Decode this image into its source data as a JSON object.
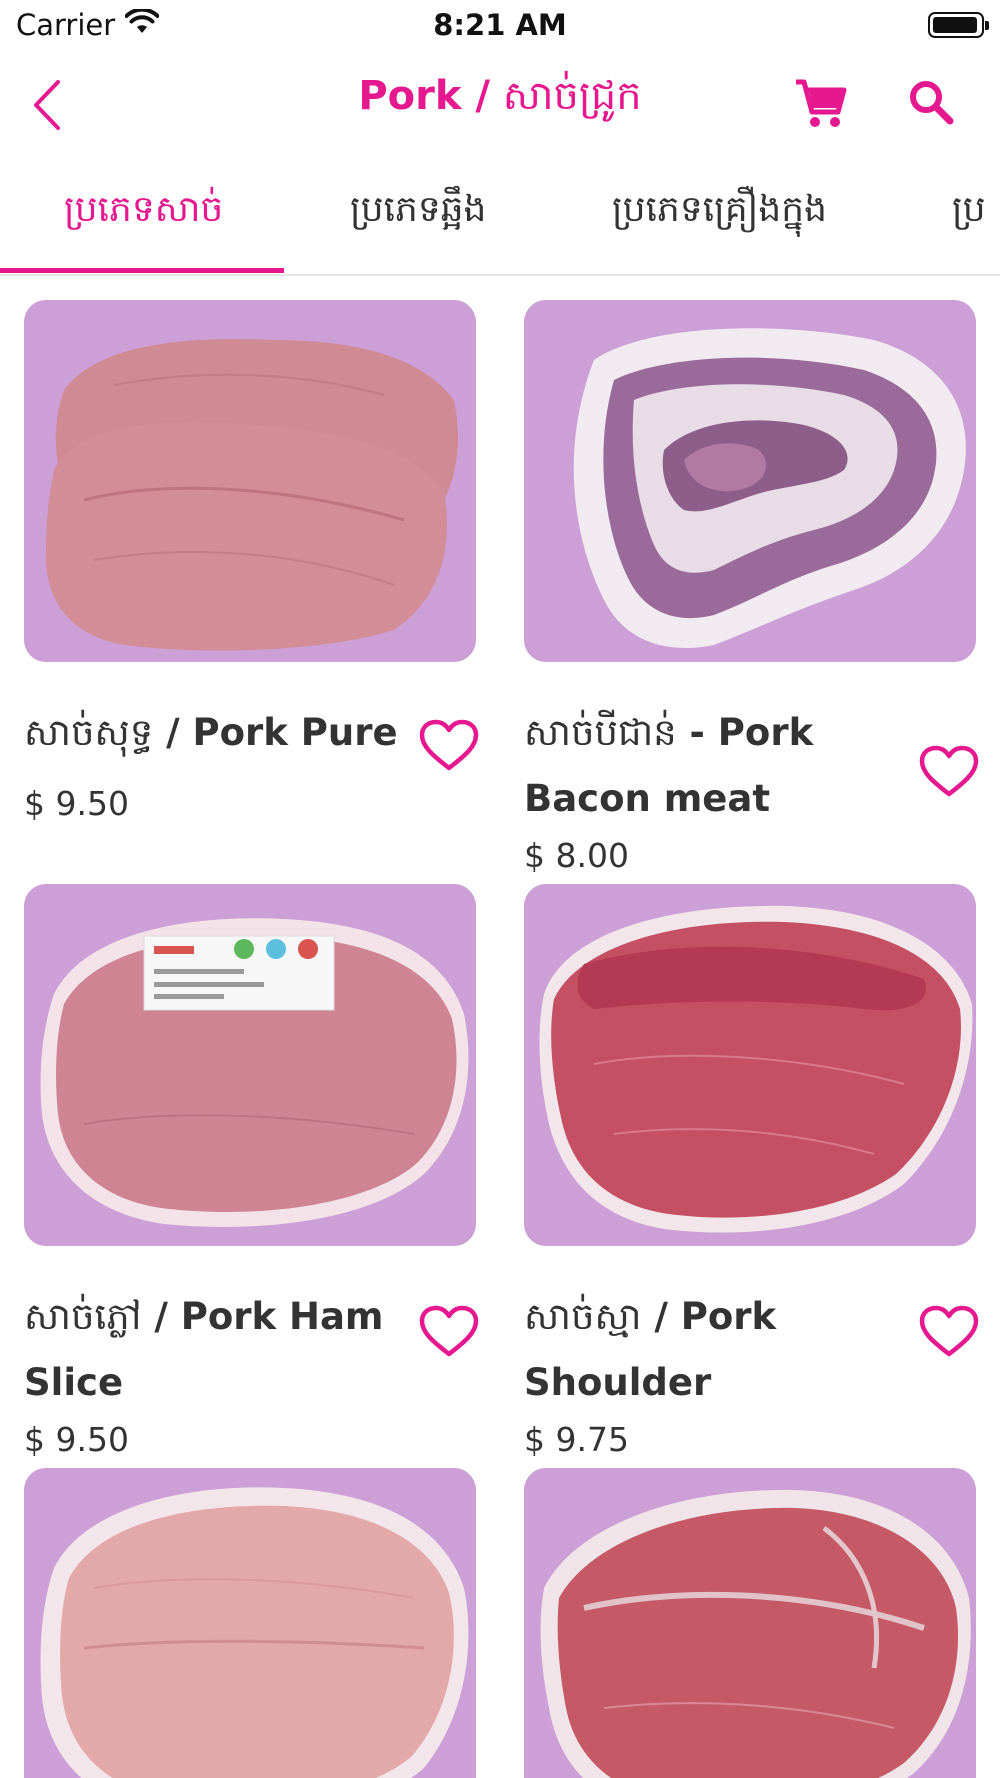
{
  "status_bar": {
    "carrier": "Carrier",
    "time": "8:21 AM"
  },
  "nav": {
    "title_en": "Pork /",
    "title_km": "សាច់ជ្រូក",
    "back_icon": "chevron-left-icon",
    "cart_icon": "cart-icon",
    "search_icon": "search-icon"
  },
  "tabs": [
    {
      "label": "ប្រភេទសាច់",
      "active": true
    },
    {
      "label": "ប្រភេទឆ្អឹង",
      "active": false
    },
    {
      "label": "ប្រភេទគ្រឿងក្នុង",
      "active": false
    },
    {
      "label": "ប្រ",
      "active": false
    }
  ],
  "products": [
    {
      "name_km": "សាច់សុទ្ធ",
      "name_en": " / Pork Pure",
      "price": "$ 9.50",
      "favorite_icon": "heart-outline-icon"
    },
    {
      "name_km": "សាច់បីជាន់",
      "name_en": " - Pork Bacon meat",
      "price": "$ 8.00",
      "favorite_icon": "heart-outline-icon"
    },
    {
      "name_km": "សាច់ភ្លៅ",
      "name_en": " / Pork Ham Slice",
      "price": "$ 9.50",
      "favorite_icon": "heart-outline-icon"
    },
    {
      "name_km": "សាច់ស្មា",
      "name_en": " / Pork Shoulder",
      "price": "$ 9.75",
      "favorite_icon": "heart-outline-icon"
    },
    {
      "name_km": "",
      "name_en": "",
      "price": "",
      "favorite_icon": "heart-outline-icon"
    },
    {
      "name_km": "",
      "name_en": "",
      "price": "",
      "favorite_icon": "heart-outline-icon"
    }
  ],
  "colors": {
    "accent": "#e5188f",
    "image_background": "#cc9fd6",
    "text": "#333333",
    "divider": "#e4e4e4"
  }
}
